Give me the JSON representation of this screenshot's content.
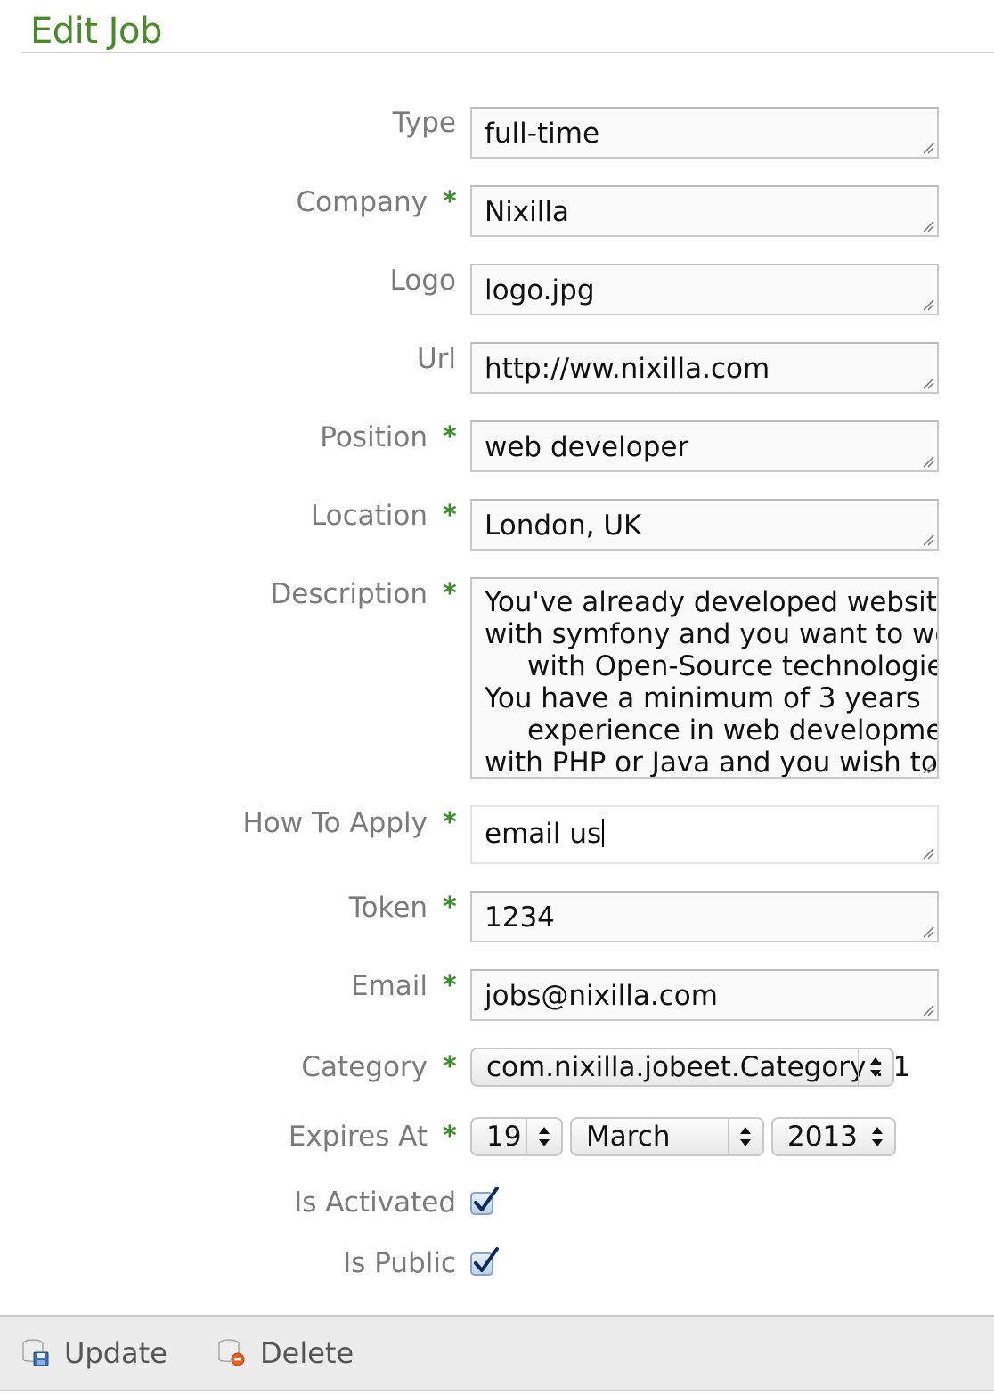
{
  "title": "Edit Job",
  "fields": {
    "type": {
      "label": "Type",
      "value": "full-time"
    },
    "company": {
      "label": "Company",
      "value": "Nixilla"
    },
    "logo": {
      "label": "Logo",
      "value": "logo.jpg"
    },
    "url": {
      "label": "Url",
      "value": "http://ww.nixilla.com"
    },
    "position": {
      "label": "Position",
      "value": "web developer"
    },
    "location": {
      "label": "Location",
      "value": "London, UK"
    },
    "description": {
      "label": "Description",
      "lines": [
        "You've already developed websites",
        "with symfony and you want to work",
        "with Open-Source technologies.",
        "You have a minimum of 3 years",
        "experience in web development",
        "with PHP or Java and you wish to"
      ]
    },
    "how_to_apply": {
      "label": "How To Apply",
      "value": "email us"
    },
    "token": {
      "label": "Token",
      "value": "1234"
    },
    "email": {
      "label": "Email",
      "value": "jobs@nixilla.com"
    },
    "category": {
      "label": "Category",
      "value": "com.nixilla.jobeet.Category : 1"
    },
    "expires_at": {
      "label": "Expires At",
      "day": "19",
      "month": "March",
      "year": "2013"
    },
    "is_activated": {
      "label": "Is Activated",
      "checked": true
    },
    "is_public": {
      "label": "Is Public",
      "checked": true
    }
  },
  "required_marker": "*",
  "actions": {
    "update": "Update",
    "delete": "Delete"
  },
  "colors": {
    "title": "#4a8a2a",
    "required": "#3c8a2a",
    "label": "#7b7b7b"
  }
}
